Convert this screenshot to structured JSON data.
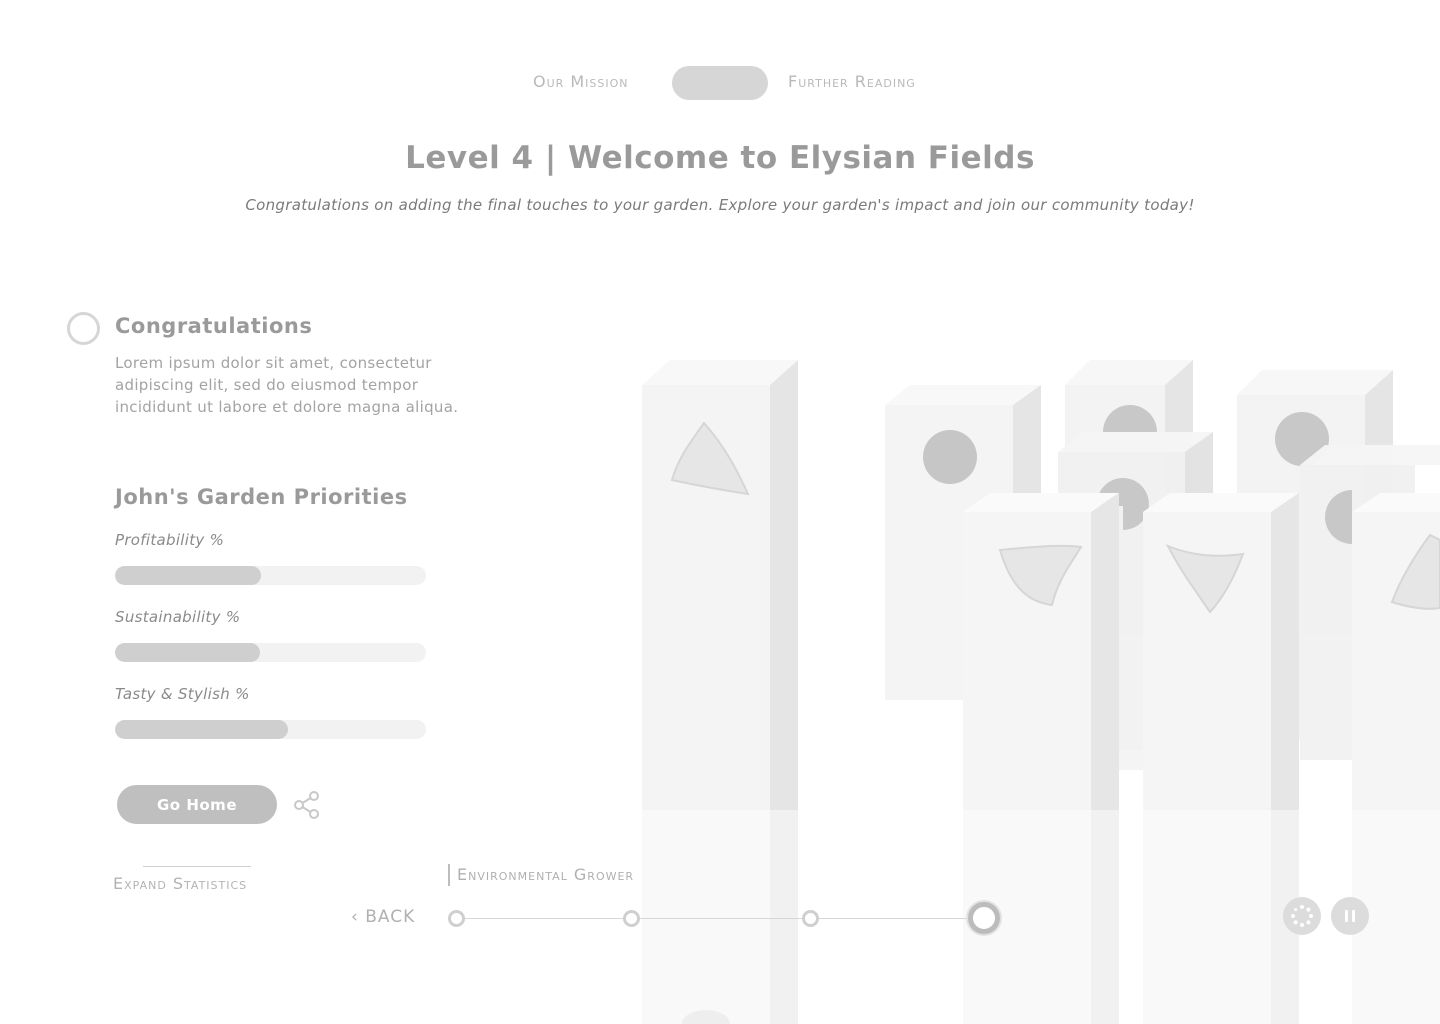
{
  "nav": {
    "mission": "Our Mission",
    "reading": "Further Reading"
  },
  "header": {
    "title": "Level 4 | Welcome to Elysian Fields",
    "subtitle": "Congratulations on adding the final touches to your garden. Explore your garden's impact and join our community today!"
  },
  "panel": {
    "heading": "Congratulations",
    "body": "Lorem ipsum dolor sit amet, consectetur adipiscing elit, sed do eiusmod tempor incididunt ut labore et dolore magna aliqua.",
    "priorities_heading": "John's Garden Priorities",
    "metrics": [
      {
        "label": "Profitability %",
        "value": 0.47
      },
      {
        "label": "Sustainability %",
        "value": 0.465
      },
      {
        "label": "Tasty & Stylish %",
        "value": 0.555
      }
    ],
    "go_home": "Go Home",
    "expand": "Expand Statistics"
  },
  "timeline": {
    "stage": "Environmental Grower",
    "back": "‹ BACK",
    "steps": 4,
    "current_step": 4
  },
  "controls": {
    "loader_icon": "loading-icon",
    "pause_icon": "pause-icon"
  },
  "colors": {
    "accent": "#bfbfbf",
    "track": "#f2f2f2",
    "fill": "#cfcfcf"
  }
}
